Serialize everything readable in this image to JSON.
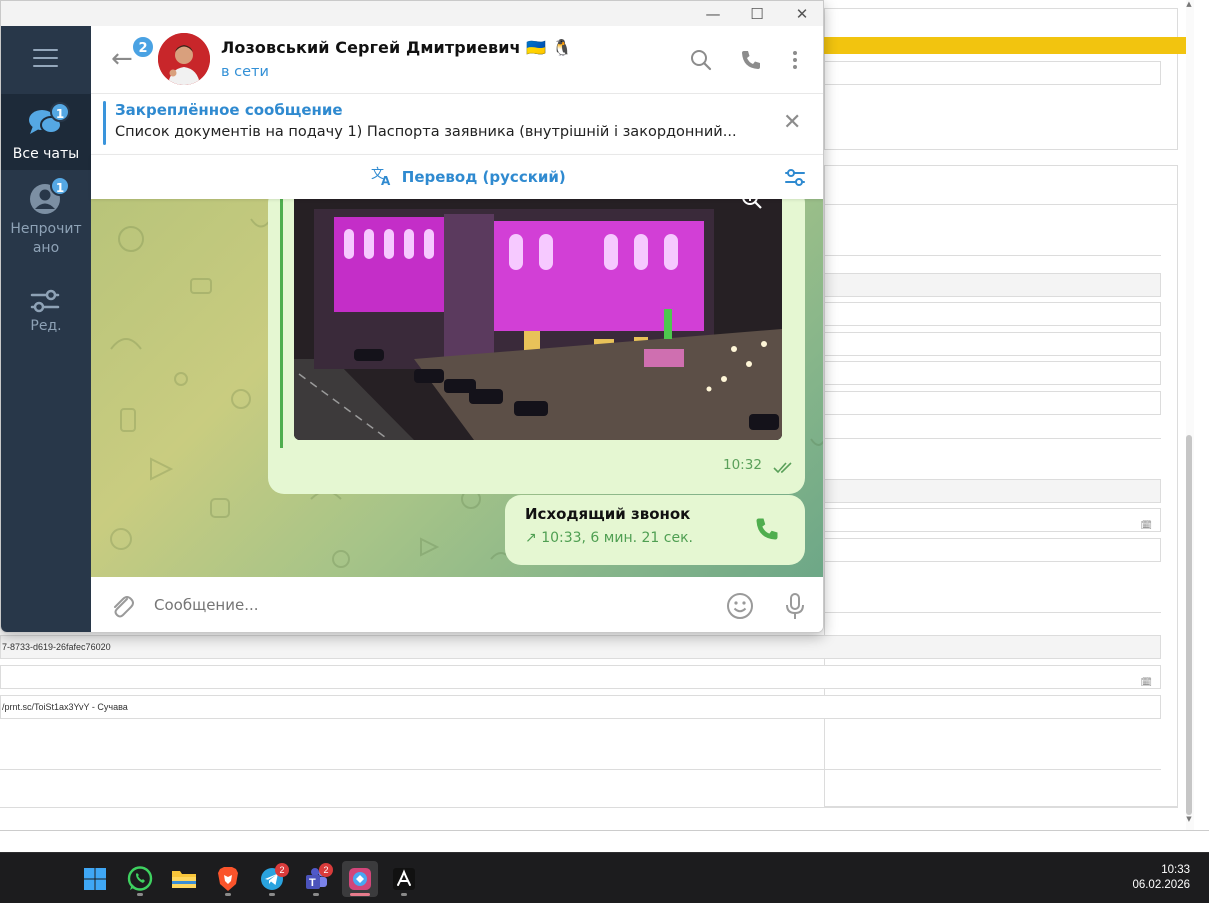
{
  "background_form": {
    "field_uuid": "7-8733-d619-26fafec76020",
    "field_link": "/prnt.sc/ToiSt1ax3YvY  - Сучава",
    "calendar_glyph": "🗓"
  },
  "window": {
    "minimize": "—",
    "maximize": "☐",
    "close": "✕"
  },
  "sidebar": {
    "folders": [
      {
        "label": "Все чаты",
        "badge": "1"
      },
      {
        "label": "Непрочит ано",
        "badge": "1"
      },
      {
        "label": "Ред."
      }
    ]
  },
  "header": {
    "back_badge": "2",
    "title": "Лозовський Сергей Дмитриевич 🇺🇦 🐧",
    "status": "в сети"
  },
  "pinned": {
    "title": "Закреплённое сообщение",
    "text": "Список документів на подачу   1) Паспорта заявника (внутрішній і закордонний..."
  },
  "translate": {
    "label": "Перевод (русский)"
  },
  "messages": {
    "photo_time": "10:32",
    "call": {
      "title": "Исходящий звонок",
      "info": "10:33, 6 мин. 21 сек."
    }
  },
  "composer": {
    "placeholder": "Сообщение..."
  },
  "taskbar": {
    "apps": [
      {
        "name": "Windows Start"
      },
      {
        "name": "WhatsApp"
      },
      {
        "name": "File Explorer"
      },
      {
        "name": "Brave"
      },
      {
        "name": "Telegram",
        "badge": "2"
      },
      {
        "name": "Teams",
        "badge": "2"
      },
      {
        "name": "Screenshot app"
      },
      {
        "name": "Adobe Acrobat"
      }
    ],
    "time": "10:33",
    "date": "06.02.2026"
  },
  "colors": {
    "sidebar": "#283749",
    "accent": "#3390d6",
    "bubble": "#e5f7d2",
    "brand_yellow": "#f2c40f"
  }
}
